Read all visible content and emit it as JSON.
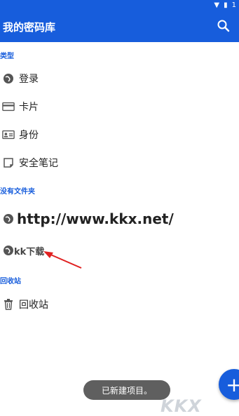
{
  "app": {
    "title": "我的密码库"
  },
  "status_icons": [
    "wifi-icon",
    "battery-icon",
    "1"
  ],
  "sections": {
    "types": "类型",
    "no_folder": "没有文件夹",
    "trash": "回收站"
  },
  "types": [
    {
      "label": "登录",
      "icon": "globe-icon"
    },
    {
      "label": "卡片",
      "icon": "card-icon"
    },
    {
      "label": "身份",
      "icon": "id-card-icon"
    },
    {
      "label": "安全笔记",
      "icon": "note-icon"
    }
  ],
  "no_folder_items": [
    {
      "label": "http://www.kkx.net/",
      "icon": "globe-icon"
    },
    {
      "label": "kk下载",
      "icon": "globe-icon"
    }
  ],
  "trash_item": {
    "label": "回收站",
    "icon": "trash-icon"
  },
  "toast": "已新建项目。",
  "fab": {
    "label": "+"
  },
  "watermark": "KKX"
}
